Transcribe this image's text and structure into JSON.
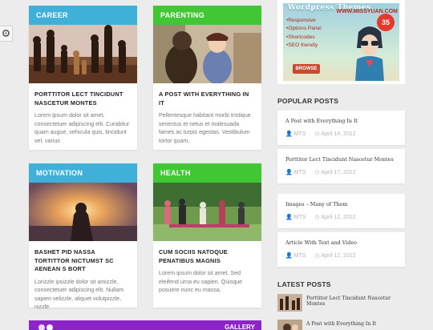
{
  "settings": {
    "icon": "gear-icon"
  },
  "cards": [
    {
      "category": "CAREER",
      "color": "#3fb1d8",
      "title": "PORTTITOR LECT TINCIDUNT NASCETUR MONTES",
      "excerpt": "Lorem ipsum dolor sit amet, consectetuer adipiscing elit. Curabitur quam augue, vehicula quis, tincidunt vel, varius"
    },
    {
      "category": "PARENTING",
      "color": "#40c733",
      "title": "A POST WITH EVERYTHING IN IT",
      "excerpt": "Pellentesque habitant morbi tristique senectus et netus et malesuada fames ac turpis egestas. Vestibulum tortor quam,"
    },
    {
      "category": "MOTIVATION",
      "color": "#3fb1d8",
      "title": "BASHET PID NASSA TORTITTOR NICTUMST SC AENEAN S BORT",
      "excerpt": "Lorizzle ipsizzle dolor sit amizzle, consectetuer adipiscing elit. Nullam sapien velizzle, aliquet volutpizzle, nizzle"
    },
    {
      "category": "HEALTH",
      "color": "#40c733",
      "title": "CUM SOCIIS NATOQUE PENATIBUS MAGNIS",
      "excerpt": "Lorem ipsum dolor sit amet. Sed eleifend urna eu sapien. Quisque posuere nunc eu massa."
    }
  ],
  "ad": {
    "title": "Wordpress Themes",
    "url": "WWW.MISSYUAN.COM",
    "badge": "35",
    "features": [
      "Responsive",
      "Options Panel",
      "Shortcodes",
      "SEO friendly"
    ],
    "button": "BROWSE"
  },
  "popular": {
    "heading": "POPULAR POSTS",
    "items": [
      {
        "title": "A Post with Everything In It",
        "author": "MTS",
        "date": "April 14, 2012"
      },
      {
        "title": "Porttitor Lect Tincidunt Nascetur Montes",
        "author": "MTS",
        "date": "April 17, 2012"
      },
      {
        "title": "Images – Many of Them",
        "author": "MTS",
        "date": "April 12, 2012"
      },
      {
        "title": "Article With Text and Video",
        "author": "MTS",
        "date": "April 12, 2012"
      }
    ]
  },
  "latest": {
    "heading": "LATEST POSTS",
    "items": [
      {
        "title": "Porttitor Lect Tincidunt Nascetur Montes"
      },
      {
        "title": "A Post with Everything In It"
      }
    ]
  },
  "gallery": {
    "label": "GALLERY",
    "color": "#8d24c8"
  }
}
